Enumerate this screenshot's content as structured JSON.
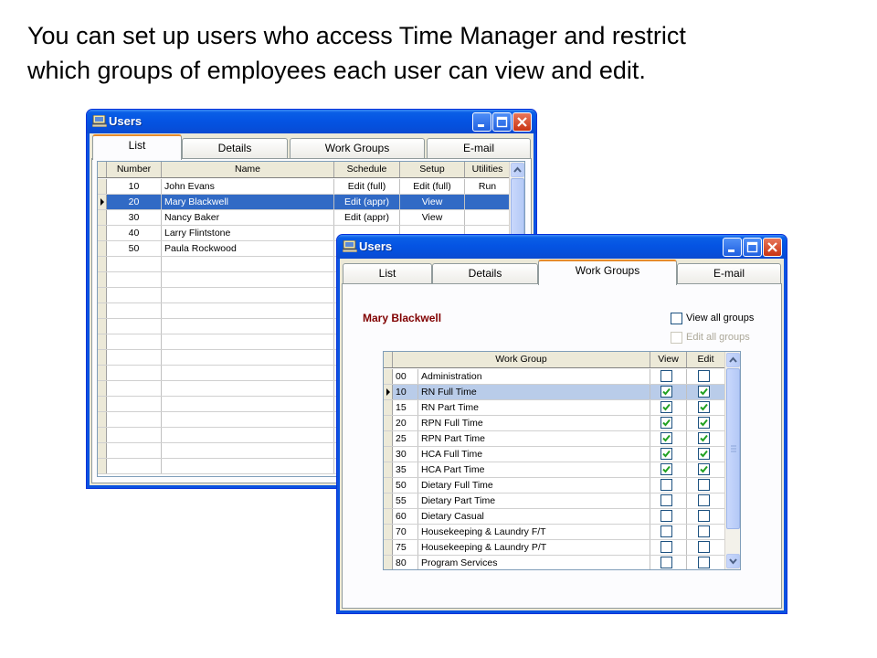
{
  "caption": {
    "line1": "You can set up users who access Time Manager and restrict",
    "line2": "which groups of employees each user can view and edit."
  },
  "window1": {
    "title": "Users",
    "tabs": [
      {
        "label": "List",
        "active": true
      },
      {
        "label": "Details"
      },
      {
        "label": "Work Groups"
      },
      {
        "label": "E-mail"
      }
    ],
    "columns": [
      "Number",
      "Name",
      "Schedule",
      "Setup",
      "Utilities"
    ],
    "rows": [
      {
        "number": "10",
        "name": "John Evans",
        "schedule": "Edit (full)",
        "setup": "Edit (full)",
        "utilities": "Run"
      },
      {
        "number": "20",
        "name": "Mary Blackwell",
        "schedule": "Edit (appr)",
        "setup": "View",
        "utilities": "",
        "selected": true
      },
      {
        "number": "30",
        "name": "Nancy Baker",
        "schedule": "Edit (appr)",
        "setup": "View",
        "utilities": ""
      },
      {
        "number": "40",
        "name": "Larry Flintstone",
        "schedule": "",
        "setup": "",
        "utilities": ""
      },
      {
        "number": "50",
        "name": "Paula Rockwood",
        "schedule": "",
        "setup": "",
        "utilities": ""
      }
    ]
  },
  "window2": {
    "title": "Users",
    "tabs": [
      {
        "label": "List"
      },
      {
        "label": "Details"
      },
      {
        "label": "Work Groups",
        "active": true
      },
      {
        "label": "E-mail"
      }
    ],
    "user_name": "Mary Blackwell",
    "view_all_label": "View all groups",
    "edit_all_label": "Edit all groups",
    "view_all_checked": false,
    "edit_all_checked": false,
    "columns": [
      "Work Group",
      "View",
      "Edit"
    ],
    "groups": [
      {
        "code": "00",
        "name": "Administration",
        "view": false,
        "edit": false
      },
      {
        "code": "10",
        "name": "RN Full Time",
        "view": true,
        "edit": true,
        "selected": true
      },
      {
        "code": "15",
        "name": "RN Part Time",
        "view": true,
        "edit": true
      },
      {
        "code": "20",
        "name": "RPN Full Time",
        "view": true,
        "edit": true
      },
      {
        "code": "25",
        "name": "RPN Part Time",
        "view": true,
        "edit": true
      },
      {
        "code": "30",
        "name": "HCA Full Time",
        "view": true,
        "edit": true
      },
      {
        "code": "35",
        "name": "HCA Part Time",
        "view": true,
        "edit": true
      },
      {
        "code": "50",
        "name": "Dietary Full Time",
        "view": false,
        "edit": false
      },
      {
        "code": "55",
        "name": "Dietary Part Time",
        "view": false,
        "edit": false
      },
      {
        "code": "60",
        "name": "Dietary Casual",
        "view": false,
        "edit": false
      },
      {
        "code": "70",
        "name": "Housekeeping & Laundry F/T",
        "view": false,
        "edit": false
      },
      {
        "code": "75",
        "name": "Housekeeping & Laundry P/T",
        "view": false,
        "edit": false
      },
      {
        "code": "80",
        "name": "Program Services",
        "view": false,
        "edit": false
      }
    ]
  },
  "colors": {
    "selection": "#316ac5",
    "selection_light": "#b9cce9",
    "user_name": "#800000",
    "titlebar": "#0554e3"
  }
}
